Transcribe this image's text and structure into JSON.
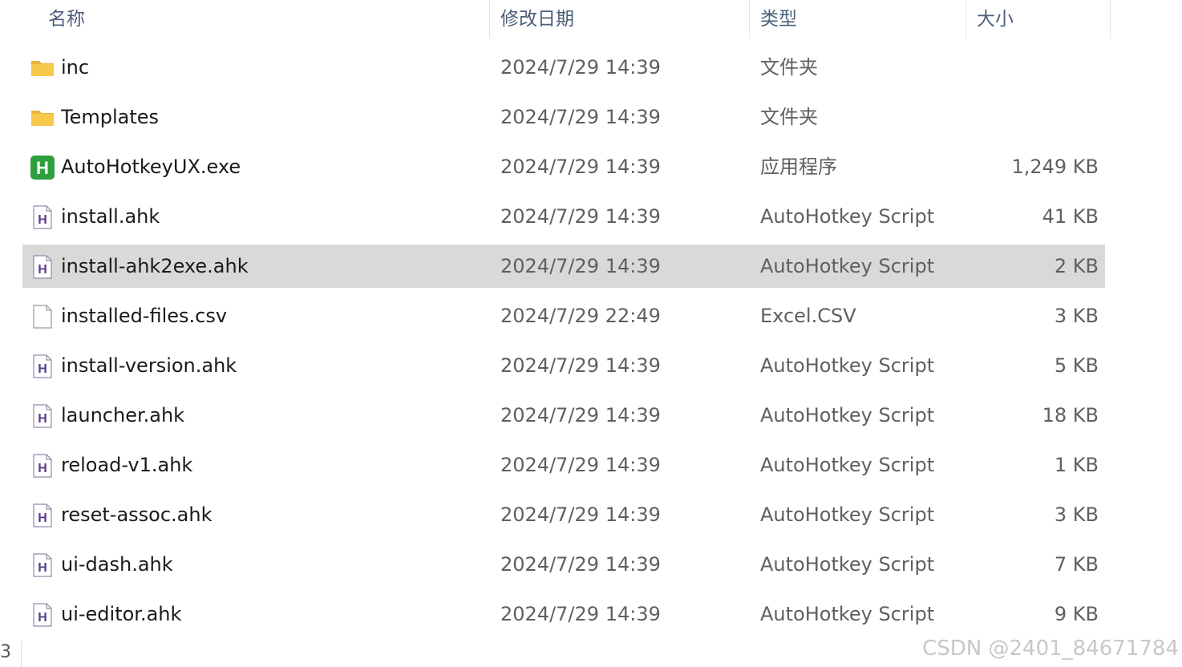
{
  "columns": {
    "name": "名称",
    "modified": "修改日期",
    "type": "类型",
    "size": "大小"
  },
  "sort_indicator": "^",
  "selected_index": 4,
  "files": [
    {
      "name": "inc",
      "modified": "2024/7/29 14:39",
      "type": "文件夹",
      "size": "",
      "icon": "folder-icon"
    },
    {
      "name": "Templates",
      "modified": "2024/7/29 14:39",
      "type": "文件夹",
      "size": "",
      "icon": "folder-icon"
    },
    {
      "name": "AutoHotkeyUX.exe",
      "modified": "2024/7/29 14:39",
      "type": "应用程序",
      "size": "1,249 KB",
      "icon": "autohotkey-exe-icon"
    },
    {
      "name": "install.ahk",
      "modified": "2024/7/29 14:39",
      "type": "AutoHotkey Script",
      "size": "41 KB",
      "icon": "ahk-script-icon"
    },
    {
      "name": "install-ahk2exe.ahk",
      "modified": "2024/7/29 14:39",
      "type": "AutoHotkey Script",
      "size": "2 KB",
      "icon": "ahk-script-icon"
    },
    {
      "name": "installed-files.csv",
      "modified": "2024/7/29 22:49",
      "type": "Excel.CSV",
      "size": "3 KB",
      "icon": "blank-file-icon"
    },
    {
      "name": "install-version.ahk",
      "modified": "2024/7/29 14:39",
      "type": "AutoHotkey Script",
      "size": "5 KB",
      "icon": "ahk-script-icon"
    },
    {
      "name": "launcher.ahk",
      "modified": "2024/7/29 14:39",
      "type": "AutoHotkey Script",
      "size": "18 KB",
      "icon": "ahk-script-icon"
    },
    {
      "name": "reload-v1.ahk",
      "modified": "2024/7/29 14:39",
      "type": "AutoHotkey Script",
      "size": "1 KB",
      "icon": "ahk-script-icon"
    },
    {
      "name": "reset-assoc.ahk",
      "modified": "2024/7/29 14:39",
      "type": "AutoHotkey Script",
      "size": "3 KB",
      "icon": "ahk-script-icon"
    },
    {
      "name": "ui-dash.ahk",
      "modified": "2024/7/29 14:39",
      "type": "AutoHotkey Script",
      "size": "7 KB",
      "icon": "ahk-script-icon"
    },
    {
      "name": "ui-editor.ahk",
      "modified": "2024/7/29 14:39",
      "type": "AutoHotkey Script",
      "size": "9 KB",
      "icon": "ahk-script-icon"
    }
  ],
  "edge_char": "3",
  "watermark": "CSDN @2401_84671784",
  "colors": {
    "selected_row": "#d9d9d9",
    "folder": "#f6c94a",
    "ahk_green": "#2e9e3e",
    "ahk_letter": "#5a3f8a"
  }
}
